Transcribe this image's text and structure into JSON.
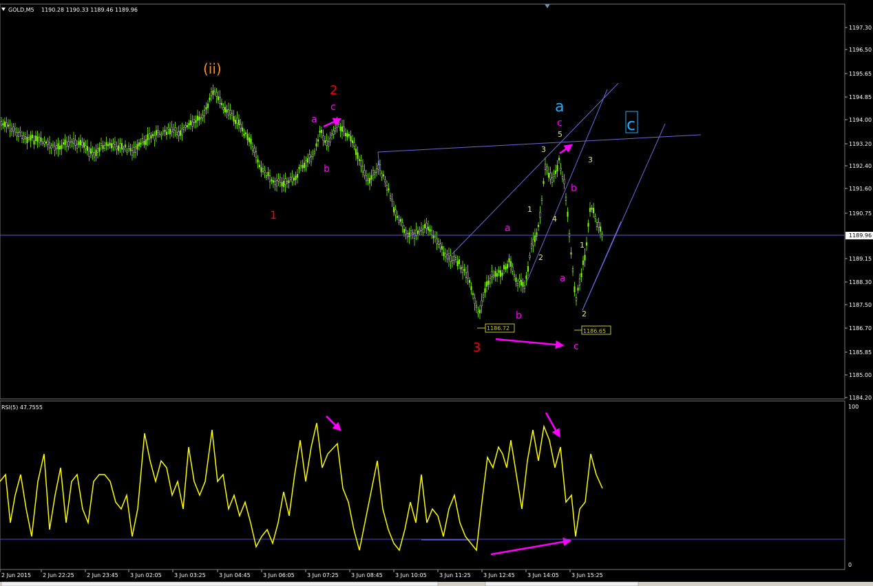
{
  "window": {
    "symbol_label": "GOLD,M5",
    "ohlc": "1190.28 1190.33 1189.46 1189.96",
    "dropdown_icon": "triangle-down-icon",
    "shift_icon": "triangle-down-icon"
  },
  "price_axis": {
    "labels": [
      "1197.30",
      "1196.50",
      "1195.65",
      "1194.85",
      "1194.00",
      "1193.20",
      "1192.40",
      "1191.60",
      "1190.75",
      "1189.96",
      "1189.15",
      "1188.30",
      "1187.50",
      "1186.70",
      "1185.85",
      "1185.00",
      "1184.20"
    ],
    "current_price": "1189.96"
  },
  "indicator": {
    "label": "RSI(5) 47.7555",
    "axis_top": "100",
    "axis_bottom": "0"
  },
  "time_axis": {
    "labels": [
      "2 Jun 2015",
      "2 Jun 22:25",
      "2 Jun 23:45",
      "3 Jun 02:05",
      "3 Jun 03:25",
      "3 Jun 04:45",
      "3 Jun 06:05",
      "3 Jun 07:25",
      "3 Jun 08:45",
      "3 Jun 10:05",
      "3 Jun 11:25",
      "3 Jun 12:45",
      "3 Jun 14:05",
      "3 Jun 15:25"
    ]
  },
  "price_tags": {
    "low1": "1186.72",
    "low2": "1186.65"
  },
  "wave_labels": {
    "ii": "(ii)",
    "red_2": "2",
    "red_1": "1",
    "red_3": "3",
    "m_a1": "a",
    "m_b1": "b",
    "m_c1": "c",
    "cyan_a": "a",
    "m_c2": "c",
    "y_5": "5",
    "y_3a": "3",
    "y_1a": "1",
    "y_4": "4",
    "y_2a": "2",
    "m_a2": "a",
    "m_b2": "b",
    "m_b3": "b",
    "m_a3": "a",
    "m_c3": "c",
    "y_3b": "3",
    "y_1b": "1",
    "y_2b": "2",
    "cyan_c": "c"
  },
  "colors": {
    "bull_candle": "#7CFC00",
    "bear_candle": "#ffffff",
    "rsi_line": "#ffff00",
    "magenta": "#ff00ff",
    "red": "#ff0000",
    "orange": "#ff8c1a",
    "cyan": "#1fb0ff",
    "yellow_label": "#e8e870",
    "trendline": "#6a6adc"
  }
}
